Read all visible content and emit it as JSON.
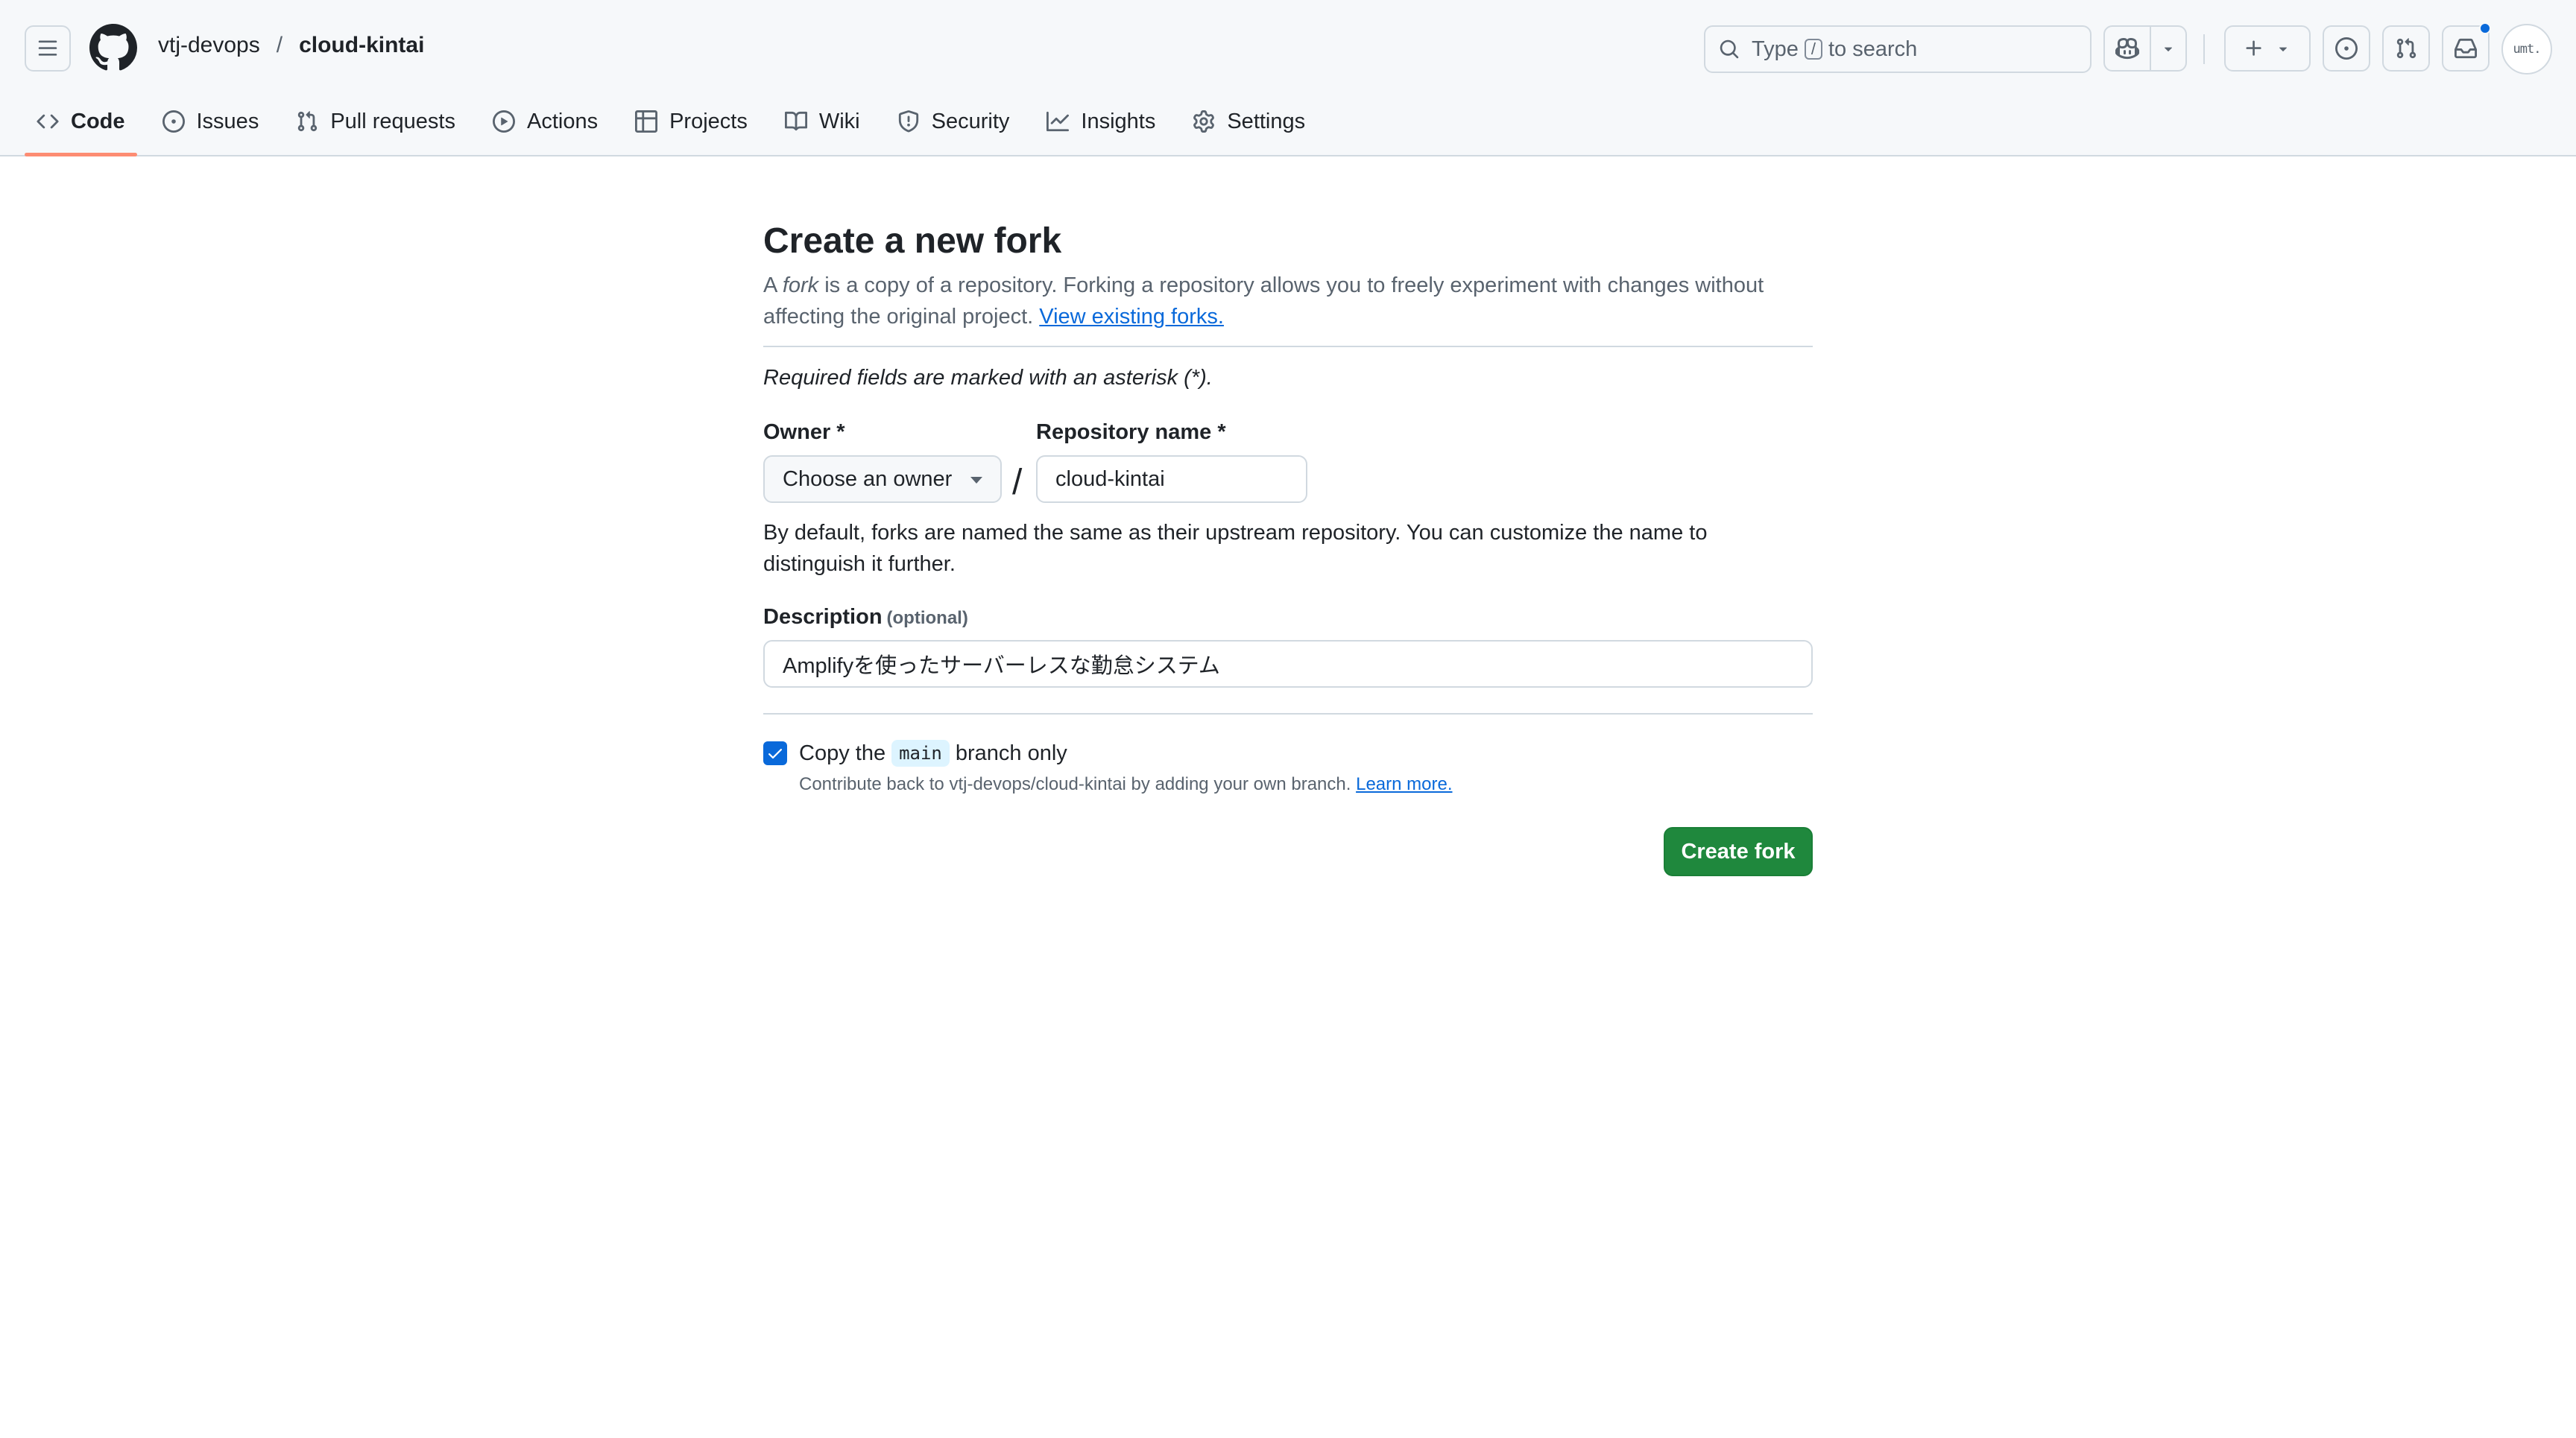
{
  "header": {
    "owner": "vtj-devops",
    "separator": "/",
    "repo": "cloud-kintai",
    "search": {
      "prefix": "Type",
      "key": "/",
      "suffix": "to search"
    }
  },
  "tabs": [
    {
      "label": "Code",
      "icon": "code-icon",
      "active": true
    },
    {
      "label": "Issues",
      "icon": "issue-opened-icon"
    },
    {
      "label": "Pull requests",
      "icon": "git-pull-request-icon"
    },
    {
      "label": "Actions",
      "icon": "play-icon"
    },
    {
      "label": "Projects",
      "icon": "table-icon"
    },
    {
      "label": "Wiki",
      "icon": "book-icon"
    },
    {
      "label": "Security",
      "icon": "shield-icon"
    },
    {
      "label": "Insights",
      "icon": "graph-icon"
    },
    {
      "label": "Settings",
      "icon": "gear-icon"
    }
  ],
  "avatar_text": "umt.",
  "form": {
    "title": "Create a new fork",
    "intro_a": "A ",
    "intro_fork": "fork",
    "intro_rest": " is a copy of a repository. Forking a repository allows you to freely experiment with changes without affecting the original project. ",
    "intro_link": "View existing forks.",
    "required_note": "Required fields are marked with an asterisk (*).",
    "owner_label": "Owner *",
    "owner_value": "Choose an owner",
    "slash": "/",
    "repo_label": "Repository name *",
    "repo_value": "cloud-kintai",
    "name_help": "By default, forks are named the same as their upstream repository. You can customize the name to distinguish it further.",
    "description_label": "Description",
    "description_optional": "(optional)",
    "description_value": "Amplifyを使ったサーバーレスな勤怠システム",
    "copy_prefix": "Copy the",
    "copy_branch": "main",
    "copy_suffix": "branch only",
    "copy_checked": true,
    "copy_note": "Contribute back to vtj-devops/cloud-kintai by adding your own branch.",
    "copy_note_link": "Learn more.",
    "create_button": "Create fork"
  },
  "colors": {
    "accent": "#0969da",
    "primary_button": "#1f883d",
    "active_tab_underline": "#fd8c73"
  }
}
